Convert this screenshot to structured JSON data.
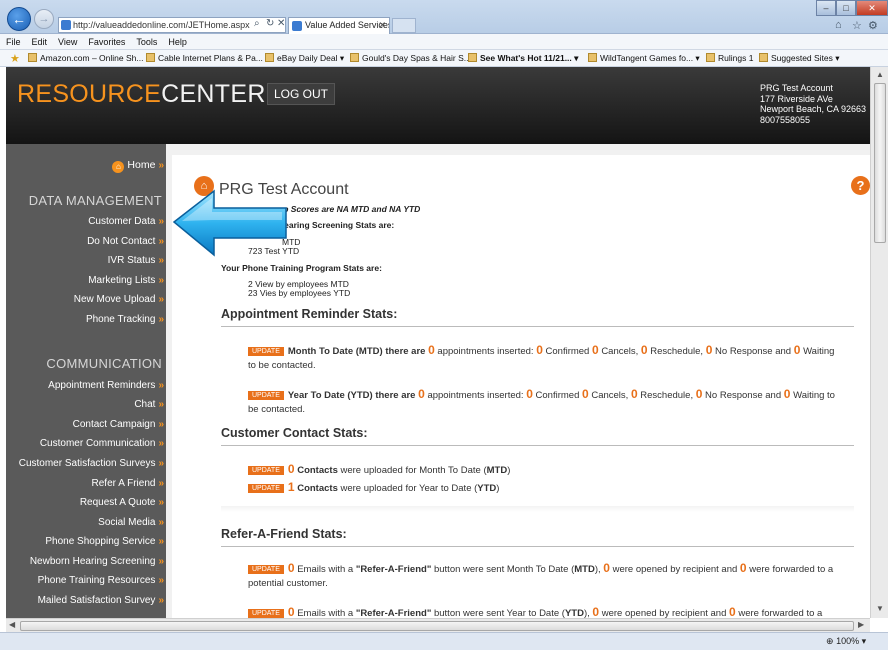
{
  "browser": {
    "url": "http://valueaddedonline.com/JETHome.aspx",
    "tab_title": "Value Added Services",
    "menu": [
      "File",
      "Edit",
      "View",
      "Favorites",
      "Tools",
      "Help"
    ],
    "favorites": [
      "Amazon.com – Online Sh...",
      "Cable Internet Plans & Pa...",
      "eBay Daily Deal ▾",
      "Gould's Day Spas & Hair S...",
      "See What's Hot 11/21... ▾",
      "WildTangent Games fo... ▾",
      "Rulings 1",
      "Suggested Sites ▾"
    ],
    "zoom": "100%"
  },
  "header": {
    "logo_a": "RESOURCE",
    "logo_b": "CENTER",
    "logout": "LOG OUT",
    "account": [
      "PRG Test Account",
      "177 Riverside AVe",
      "Newport Beach, CA 92663",
      "8007558055"
    ]
  },
  "sidebar": {
    "home": "Home",
    "data_heading": "DATA MANAGEMENT",
    "data_items": [
      "Customer Data",
      "Do Not Contact",
      "IVR Status",
      "Marketing Lists",
      "New Move Upload",
      "Phone Tracking"
    ],
    "comm_heading": "COMMUNICATION",
    "comm_items": [
      "Appointment Reminders",
      "Chat",
      "Contact Campaign",
      "Customer Communication",
      "Customer Satisfaction Surveys",
      "Refer A Friend",
      "Request A Quote",
      "Social Media",
      "Phone Shopping Service",
      "Newborn Hearing Screening",
      "Phone Training Resources",
      "Mailed Satisfaction Survey"
    ],
    "arrow": "»"
  },
  "main": {
    "title": "PRG Test Account",
    "help": "?",
    "intro": {
      "line1": "op Scores are NA MTD and NA YTD",
      "line2": "Hearing Screening Stats are:",
      "line3": "MTD",
      "line4": "723 Test YTD",
      "line5": "Your Phone Training Program Stats are:",
      "line6": "2 View by employees MTD",
      "line7": "23 Vies by employees YTD"
    },
    "update": "UPDATE",
    "appt": {
      "heading": "Appointment Reminder Stats:",
      "mtd_label": "Month To Date (MTD) there are",
      "ytd_label": "Year To Date (YTD) there are",
      "t_inserted": "appointments inserted:",
      "t_confirmed": "Confirmed",
      "t_cancels": "Cancels,",
      "t_resched": "Reschedule,",
      "t_noresp": "No Response and",
      "t_waiting": "Waiting to be contacted.",
      "zero": "0"
    },
    "contact": {
      "heading": "Customer Contact Stats:",
      "mtd_num": "0",
      "ytd_num": "1",
      "contacts": "Contacts",
      "mtd_text": "were uploaded for Month To Date (",
      "ytd_text": "were uploaded for Year to Date (",
      "mtd": "MTD",
      "ytd": "YTD",
      "close": ")"
    },
    "raf": {
      "heading": "Refer-A-Friend Stats:",
      "zero": "0",
      "emails_with": "Emails with a",
      "raf_btn": "\"Refer-A-Friend\"",
      "sent_mtd": "button were sent Month To Date (",
      "sent_ytd": "button were sent Year to Date (",
      "mtd": "MTD",
      "ytd": "YTD",
      "opened": "), ",
      "opened2": "were opened by recipient and",
      "forwarded": "were forwarded to a potential customer.",
      "forwarded_short": "were forwarded to a"
    }
  }
}
